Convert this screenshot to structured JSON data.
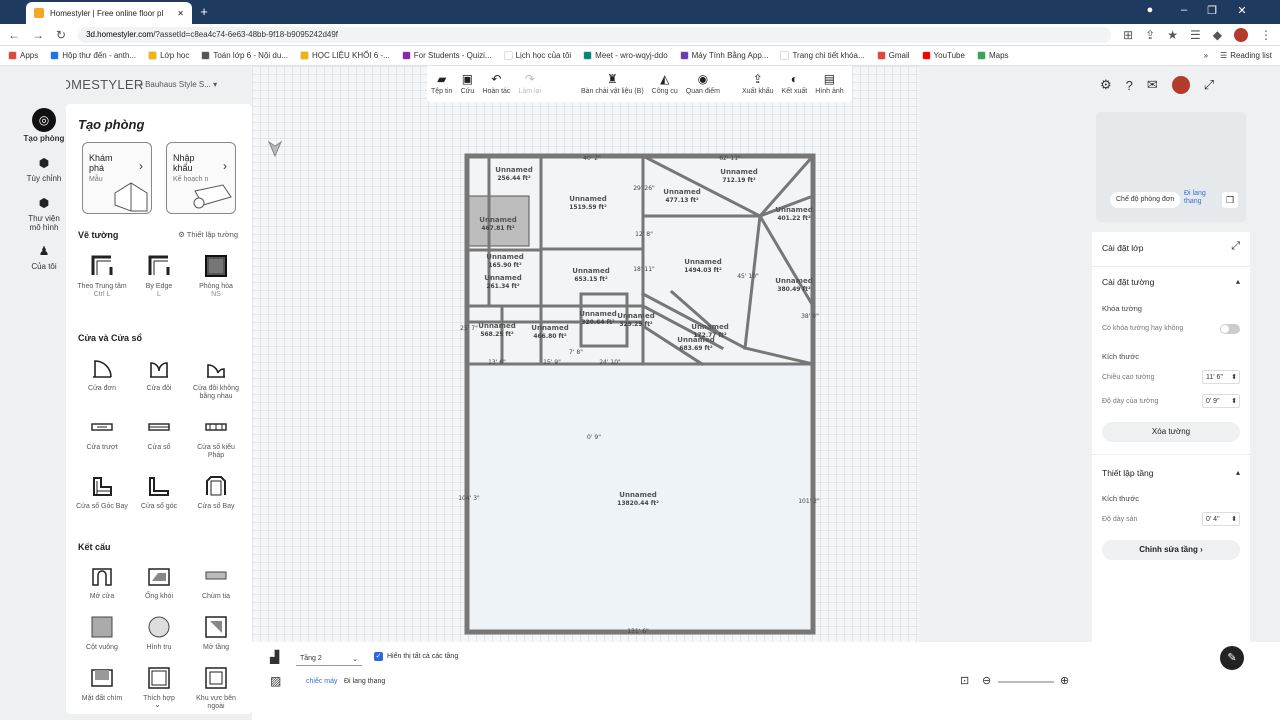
{
  "browser": {
    "tab_title": "Homestyler | Free online floor pl",
    "url_host": "3d.homestyler.com",
    "url_path": "/?assetId=c8ea4c74-6e63-48bb-9f18-b9095242d49f",
    "bookmarks": [
      {
        "label": "Apps",
        "color": "#e04a3b"
      },
      {
        "label": "Hộp thư đến - anth...",
        "color": "#1a73e8"
      },
      {
        "label": "Lớp học",
        "color": "#f4b400"
      },
      {
        "label": "Toán lớp 6 - Nội du...",
        "color": "#555555"
      },
      {
        "label": "HỌC LIỆU KHỐI 6 -...",
        "color": "#f4b400"
      },
      {
        "label": "For Students - Quizi...",
        "color": "#8e24aa"
      },
      {
        "label": "Lịch học của tôi",
        "color": "#ffffff"
      },
      {
        "label": "Meet - wro-wqyj-ddo",
        "color": "#00897b"
      },
      {
        "label": "Máy Tính Bằng App...",
        "color": "#673ab7"
      },
      {
        "label": "Trang chi tiết khóa...",
        "color": "#ffffff"
      },
      {
        "label": "Gmail",
        "color": "#ea4335"
      },
      {
        "label": "YouTube",
        "color": "#ff0000"
      },
      {
        "label": "Maps",
        "color": "#34a853"
      }
    ],
    "reading_list": "Reading list"
  },
  "app": {
    "logo": "HOMESTYLER",
    "project": "Bauhaus Style S...",
    "nav": [
      {
        "label": "Tạo phòng",
        "icon": "create-room-icon"
      },
      {
        "label": "Tùy chỉnh",
        "icon": "customize-icon"
      },
      {
        "label": "Thư viện mô hình",
        "icon": "model-library-icon"
      },
      {
        "label": "Của tôi",
        "icon": "my-items-icon"
      }
    ],
    "panel": {
      "title": "Tạo phòng",
      "cards": [
        {
          "title": "Khám phá",
          "sub": "Mẫu"
        },
        {
          "title": "Nhập khẩu",
          "sub": "Kế hoạch n"
        }
      ],
      "wall_section": "Vẽ tường",
      "wall_settings": "Thiết lập tường",
      "wall_tools": [
        {
          "label": "Theo Trung tâm",
          "shortcut": "Ctrl L"
        },
        {
          "label": "By Edge",
          "shortcut": "L"
        },
        {
          "label": "Phòng hòa",
          "shortcut": "NS"
        }
      ],
      "door_section": "Cửa và Cửa sổ",
      "door_tools": [
        "Cửa đơn",
        "Cửa đôi",
        "Cửa đôi không bằng nhau",
        "Cửa trượt",
        "Cửa sổ",
        "Cửa sổ kiểu Pháp",
        "Cửa sổ Góc Bay",
        "Cửa sổ góc",
        "Cửa sổ Bay"
      ],
      "struct_section": "Kết cấu",
      "struct_tools": [
        "Mở cửa",
        "Ống khói",
        "Chùm tia",
        "Cột vuông",
        "Hình trụ",
        "Mở tầng",
        "Mặt đất chìm",
        "Thích hợp",
        "Khu vực bên ngoài"
      ]
    },
    "toolbar": [
      {
        "label": "Tệp tin",
        "icon": "folder-icon",
        "disabled": false
      },
      {
        "label": "Cứu",
        "icon": "save-icon",
        "disabled": false
      },
      {
        "label": "Hoàn tác",
        "icon": "undo-icon",
        "disabled": false
      },
      {
        "label": "Làm lại",
        "icon": "redo-icon",
        "disabled": true
      },
      {
        "label": "Bàn chải vật liệu (B)",
        "icon": "brush-icon",
        "disabled": false
      },
      {
        "label": "Công cụ",
        "icon": "tools-icon",
        "disabled": false
      },
      {
        "label": "Quan điểm",
        "icon": "eye-icon",
        "disabled": false
      },
      {
        "label": "Xuất khẩu",
        "icon": "export-icon",
        "disabled": false
      },
      {
        "label": "Kết xuất",
        "icon": "render-icon",
        "disabled": false
      },
      {
        "label": "Hình ảnh",
        "icon": "image-icon",
        "disabled": false
      }
    ],
    "preview": {
      "mode": "Chế độ phòng đơn",
      "walk": "Đi lang thang"
    },
    "right": {
      "layer_settings": "Cài đặt lớp",
      "wall_settings": "Cài đặt tường",
      "wall_lock": "Khóa tường",
      "wall_lock_q": "Có khóa tường hay không",
      "size": "Kích thước",
      "wall_height_label": "Chiều cao tường",
      "wall_height": "11' 6\"",
      "wall_thick_label": "Độ dày của tường",
      "wall_thick": "0' 9\"",
      "delete_wall": "Xóa tường",
      "floor_settings": "Thiết lập tầng",
      "floor_size": "Kích thước",
      "floor_thick_label": "Độ dày sàn",
      "floor_thick": "0' 4\"",
      "edit_floor": "Chỉnh sửa tầng ›"
    },
    "bottom": {
      "floor_select": "Tầng 2",
      "show_all": "Hiển thị tất cả các tầng",
      "camera": "chiếc máy",
      "walk": "Đi lang thang"
    },
    "rooms": [
      {
        "name": "Unnamed",
        "area": "256.44 ft²"
      },
      {
        "name": "Unnamed",
        "area": "1519.59 ft²"
      },
      {
        "name": "Unnamed",
        "area": "477.13 ft²"
      },
      {
        "name": "Unnamed",
        "area": "712.19 ft²"
      },
      {
        "name": "Unnamed",
        "area": "401.22 ft²"
      },
      {
        "name": "Unnamed",
        "area": "467.81 ft²"
      },
      {
        "name": "Unnamed",
        "area": "165.90 ft²"
      },
      {
        "name": "Unnamed",
        "area": "653.15 ft²"
      },
      {
        "name": "Unnamed",
        "area": "1494.03 ft²"
      },
      {
        "name": "Unnamed",
        "area": "380.49 ft²"
      },
      {
        "name": "Unnamed",
        "area": "261.34 ft²"
      },
      {
        "name": "Unnamed",
        "area": "320.64 ft²"
      },
      {
        "name": "Unnamed",
        "area": "329.29 ft²"
      },
      {
        "name": "Unnamed",
        "area": "172.77 ft²"
      },
      {
        "name": "Unnamed",
        "area": "568.25 ft²"
      },
      {
        "name": "Unnamed",
        "area": "466.80 ft²"
      },
      {
        "name": "Unnamed",
        "area": "683.69 ft²"
      },
      {
        "name": "Unnamed",
        "area": "13820.44 ft²"
      }
    ],
    "dims": [
      "40' 2\"",
      "62' 11\"",
      "104' 3\"",
      "101' 2\"",
      "131' 6\"",
      "29' 26\"",
      "38' 9\"",
      "45' 10\"",
      "12' 8\"",
      "18' 11\"",
      "25' 7\"",
      "13' 6\"",
      "15' 9\"",
      "24' 10\"",
      "7' 8\"",
      "0' 9\""
    ]
  }
}
